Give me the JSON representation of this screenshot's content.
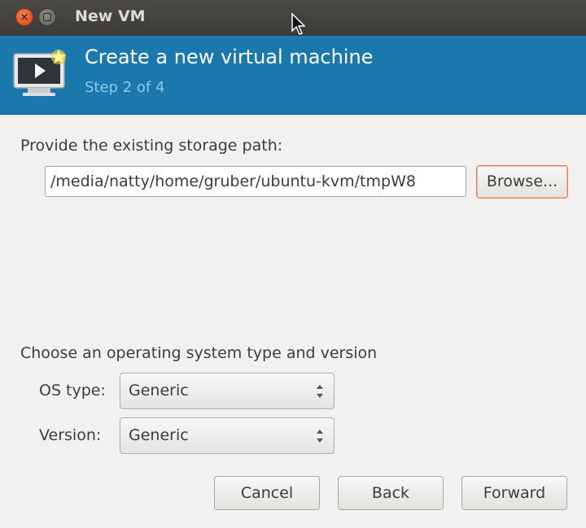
{
  "window": {
    "title": "New VM"
  },
  "header": {
    "title": "Create a new virtual machine",
    "step": "Step 2 of 4",
    "icon": "virtual-machine-icon"
  },
  "storage": {
    "label": "Provide the existing storage path:",
    "path_value": "/media/natty/home/gruber/ubuntu-kvm/tmpW8",
    "browse_label": "Browse..."
  },
  "os": {
    "section_label": "Choose an operating system type and version",
    "type_label": "OS type:",
    "type_value": "Generic",
    "version_label": "Version:",
    "version_value": "Generic"
  },
  "footer": {
    "cancel_label": "Cancel",
    "back_label": "Back",
    "forward_label": "Forward"
  },
  "colors": {
    "banner": "#1b78ac",
    "titlebar": "#3c3b37",
    "close_button": "#e2561f",
    "browse_focus": "#e47e5a"
  }
}
